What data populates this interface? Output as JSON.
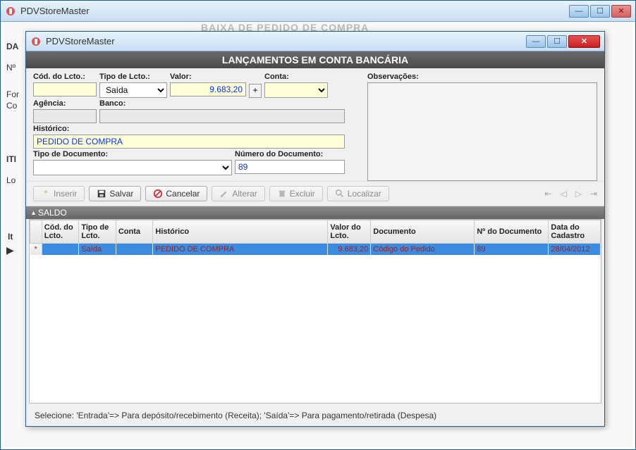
{
  "outer": {
    "title": "PDVStoreMaster",
    "banner_partial": "BAIXA DE PEDIDO DE COMPRA",
    "back_labels": {
      "da": "DA",
      "no": "Nº",
      "for": "For",
      "co": "Co",
      "iti": "ITI",
      "lo": "Lo",
      "it": "It"
    }
  },
  "modal": {
    "title": "PDVStoreMaster",
    "header": "LANÇAMENTOS EM CONTA BANCÁRIA",
    "labels": {
      "cod_lcto": "Cód. do Lcto.:",
      "tipo_lcto": "Tipo de Lcto.:",
      "valor": "Valor:",
      "conta": "Conta:",
      "observacoes": "Observações:",
      "agencia": "Agência:",
      "banco": "Banco:",
      "historico": "Histórico:",
      "tipo_doc": "Tipo de Documento:",
      "num_doc": "Número do Documento:"
    },
    "values": {
      "cod_lcto": "",
      "tipo_lcto": "Saída",
      "valor": "9.683,20",
      "conta": "",
      "observacoes": "",
      "agencia": "",
      "banco": "",
      "historico": "PEDIDO DE COMPRA",
      "tipo_doc": "",
      "num_doc": "89",
      "plus": "+"
    },
    "toolbar": {
      "inserir": "Inserir",
      "salvar": "Salvar",
      "cancelar": "Cancelar",
      "alterar": "Alterar",
      "excluir": "Excluir",
      "localizar": "Localizar"
    },
    "section_saldo": "SALDO",
    "grid": {
      "columns": {
        "rowmark": "*",
        "cod": "Cód. do Lcto.",
        "tipo": "Tipo de Lcto.",
        "conta": "Conta",
        "historico": "Histórico",
        "valor": "Valor do Lcto.",
        "documento": "Documento",
        "numdoc": "Nº do Documento",
        "data": "Data do Cadastro"
      },
      "rows": [
        {
          "cod": "",
          "tipo": "Saída",
          "conta": "",
          "historico": "PEDIDO DE COMPRA",
          "valor": "9.683,20",
          "documento": "Código do Pedido",
          "numdoc": "89",
          "data": "28/04/2012"
        }
      ]
    },
    "status": "Selecione: 'Entrada'=> Para depósito/recebimento (Receita); 'Saída'=> Para pagamento/retirada (Despesa)"
  }
}
